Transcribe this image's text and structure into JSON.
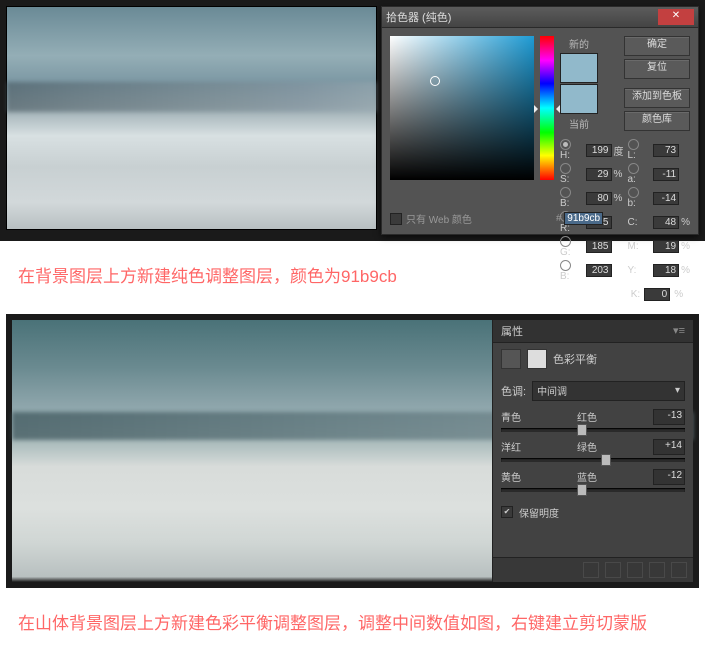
{
  "colorPicker": {
    "title": "拾色器 (纯色)",
    "ok": "确定",
    "cancel": "复位",
    "addSwatch": "添加到色板",
    "colorLib": "颜色库",
    "newLabel": "新的",
    "currentLabel": "当前",
    "newColor": "#91b9cb",
    "currentColor": "#91b9cb",
    "webOnly": "只有 Web 颜色",
    "hexPrefix": "#",
    "hex": "91b9cb",
    "fields": {
      "H": {
        "label": "H:",
        "val": "199",
        "unit": "度"
      },
      "S": {
        "label": "S:",
        "val": "29",
        "unit": "%"
      },
      "Bv": {
        "label": "B:",
        "val": "80",
        "unit": "%"
      },
      "R": {
        "label": "R:",
        "val": "145",
        "unit": ""
      },
      "G": {
        "label": "G:",
        "val": "185",
        "unit": ""
      },
      "Bl": {
        "label": "B:",
        "val": "203",
        "unit": ""
      },
      "L": {
        "label": "L:",
        "val": "73",
        "unit": ""
      },
      "a": {
        "label": "a:",
        "val": "-11",
        "unit": ""
      },
      "b": {
        "label": "b:",
        "val": "-14",
        "unit": ""
      },
      "C": {
        "label": "C:",
        "val": "48",
        "unit": "%"
      },
      "M": {
        "label": "M:",
        "val": "19",
        "unit": "%"
      },
      "Y": {
        "label": "Y:",
        "val": "18",
        "unit": "%"
      },
      "K": {
        "label": "K:",
        "val": "0",
        "unit": "%"
      }
    }
  },
  "caption1": "在背景图层上方新建纯色调整图层，颜色为91b9cb",
  "properties": {
    "tab": "属性",
    "type": "色彩平衡",
    "toneLabel": "色调:",
    "toneValue": "中间调",
    "sliders": [
      {
        "left": "青色",
        "right": "红色",
        "val": "-13",
        "pos": 44
      },
      {
        "left": "洋红",
        "right": "绿色",
        "val": "+14",
        "pos": 57
      },
      {
        "left": "黄色",
        "right": "蓝色",
        "val": "-12",
        "pos": 44
      }
    ],
    "preserve": "保留明度"
  },
  "caption2": "在山体背景图层上方新建色彩平衡调整图层，调整中间数值如图，右键建立剪切蒙版"
}
